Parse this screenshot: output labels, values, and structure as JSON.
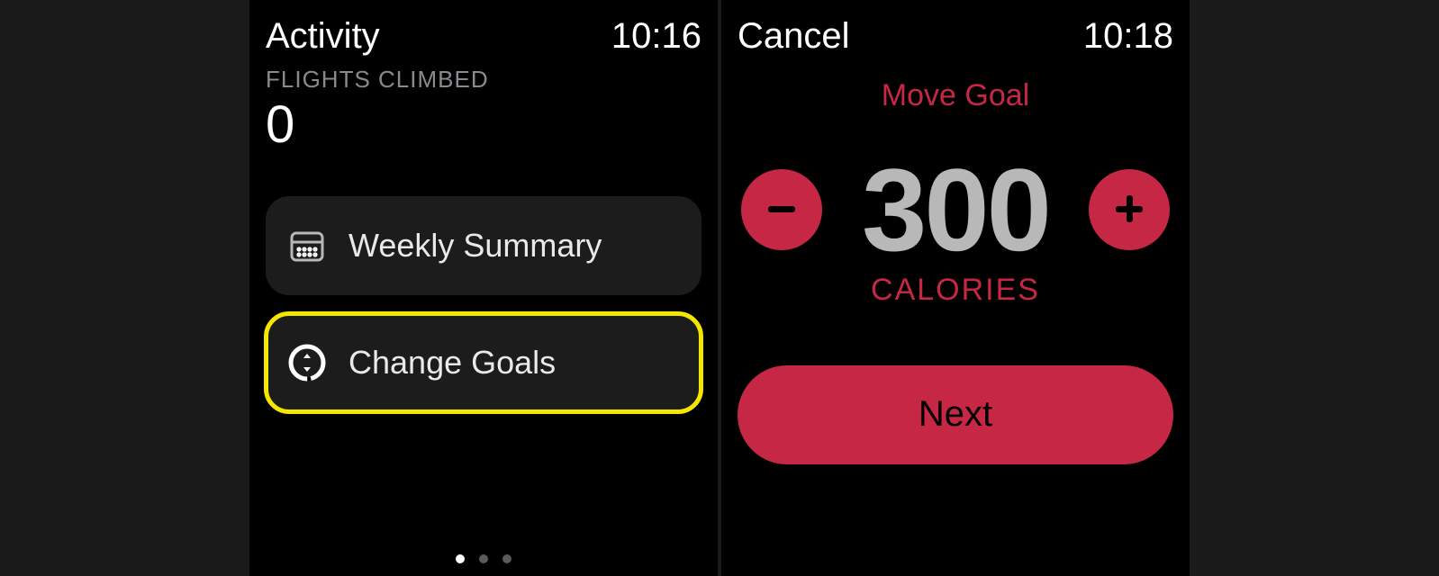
{
  "screen1": {
    "title": "Activity",
    "time": "10:16",
    "metric": {
      "label": "FLIGHTS CLIMBED",
      "value": "0"
    },
    "buttons": {
      "weekly_summary": "Weekly Summary",
      "change_goals": "Change Goals"
    }
  },
  "screen2": {
    "cancel": "Cancel",
    "time": "10:18",
    "goal_title": "Move Goal",
    "goal_value": "300",
    "goal_unit": "CALORIES",
    "next": "Next"
  },
  "colors": {
    "accent": "#c62744",
    "highlight": "#f5e600"
  }
}
